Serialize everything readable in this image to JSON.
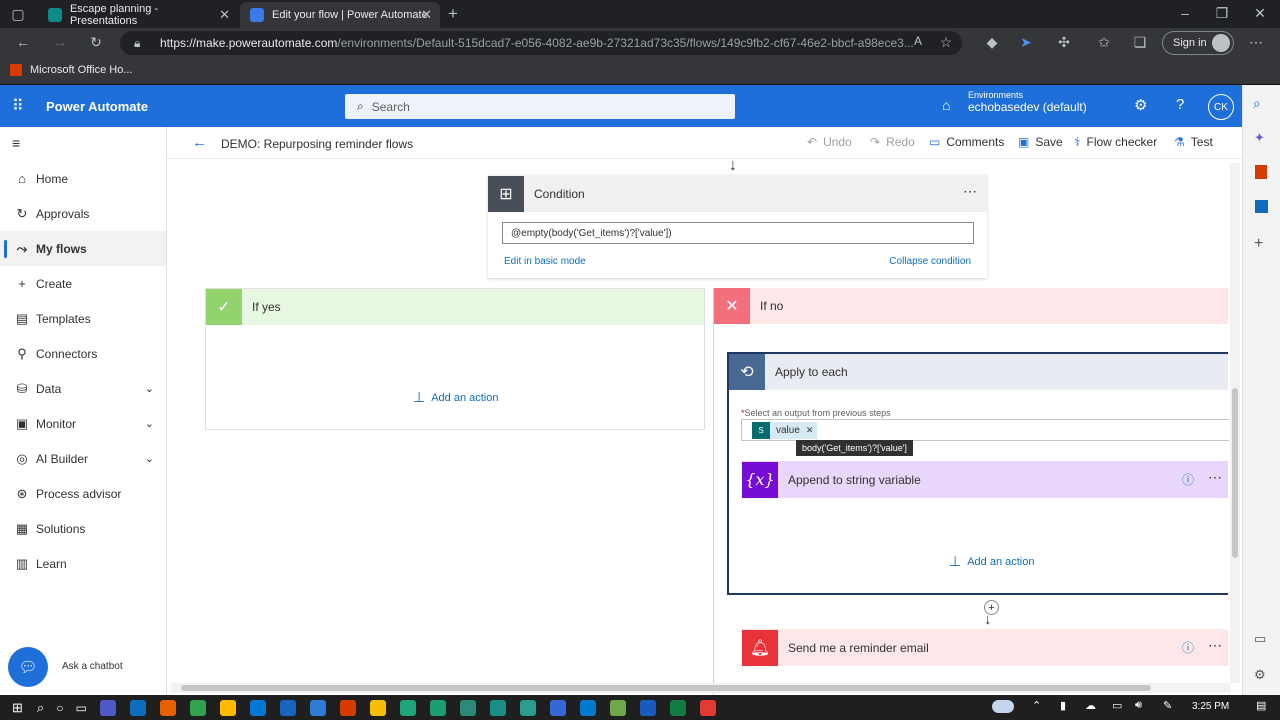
{
  "browser": {
    "tabs": [
      {
        "label": "Escape planning - Presentations"
      },
      {
        "label": "Edit your flow | Power Automate"
      }
    ],
    "url_host": "https://make.powerautomate.com",
    "url_path": "/environments/Default-515dcad7-e056-4082-ae9b-27321ad73c35/flows/149c9fb2-cf67-46e2-bbcf-a98ece3...",
    "sign_in": "Sign in",
    "favorite": "Microsoft Office Ho..."
  },
  "header": {
    "brand": "Power Automate",
    "search_placeholder": "Search",
    "env_label": "Environments",
    "env_name": "echobasedev (default)",
    "avatar": "CK"
  },
  "sidebar": {
    "items": [
      {
        "label": "Home",
        "icon": "home-icon"
      },
      {
        "label": "Approvals",
        "icon": "approvals-icon"
      },
      {
        "label": "My flows",
        "icon": "flows-icon"
      },
      {
        "label": "Create",
        "icon": "plus-icon"
      },
      {
        "label": "Templates",
        "icon": "templates-icon"
      },
      {
        "label": "Connectors",
        "icon": "connectors-icon"
      },
      {
        "label": "Data",
        "icon": "data-icon"
      },
      {
        "label": "Monitor",
        "icon": "monitor-icon"
      },
      {
        "label": "AI Builder",
        "icon": "ai-builder-icon"
      },
      {
        "label": "Process advisor",
        "icon": "process-advisor-icon"
      },
      {
        "label": "Solutions",
        "icon": "solutions-icon"
      },
      {
        "label": "Learn",
        "icon": "learn-icon"
      }
    ],
    "chatbot": "Ask a chatbot"
  },
  "command_bar": {
    "flow_title": "DEMO: Repurposing reminder flows",
    "undo": "Undo",
    "redo": "Redo",
    "comments": "Comments",
    "save": "Save",
    "flow_checker": "Flow checker",
    "test": "Test"
  },
  "canvas": {
    "condition": {
      "title": "Condition",
      "expression": "@empty(body('Get_items')?['value'])",
      "edit_basic": "Edit in basic mode",
      "collapse": "Collapse condition"
    },
    "if_yes": {
      "title": "If yes",
      "add_action": "Add an action"
    },
    "if_no": {
      "title": "If no"
    },
    "apply_to_each": {
      "title": "Apply to each",
      "field_label": "Select an output from previous steps",
      "token": "value",
      "tooltip": "body('Get_items')?['value']"
    },
    "append": {
      "title": "Append to string variable",
      "icon_text": "{x}"
    },
    "inner_add_action": "Add an action",
    "reminder": {
      "title": "Send me a reminder email"
    }
  },
  "taskbar": {
    "time": "3:25 PM"
  },
  "colors": {
    "header_blue": "#1e6fd9",
    "yes_green": "#92d36e",
    "no_red": "#f1707b",
    "append_purple": "#770bd6",
    "reminder_red": "#e8333a"
  }
}
